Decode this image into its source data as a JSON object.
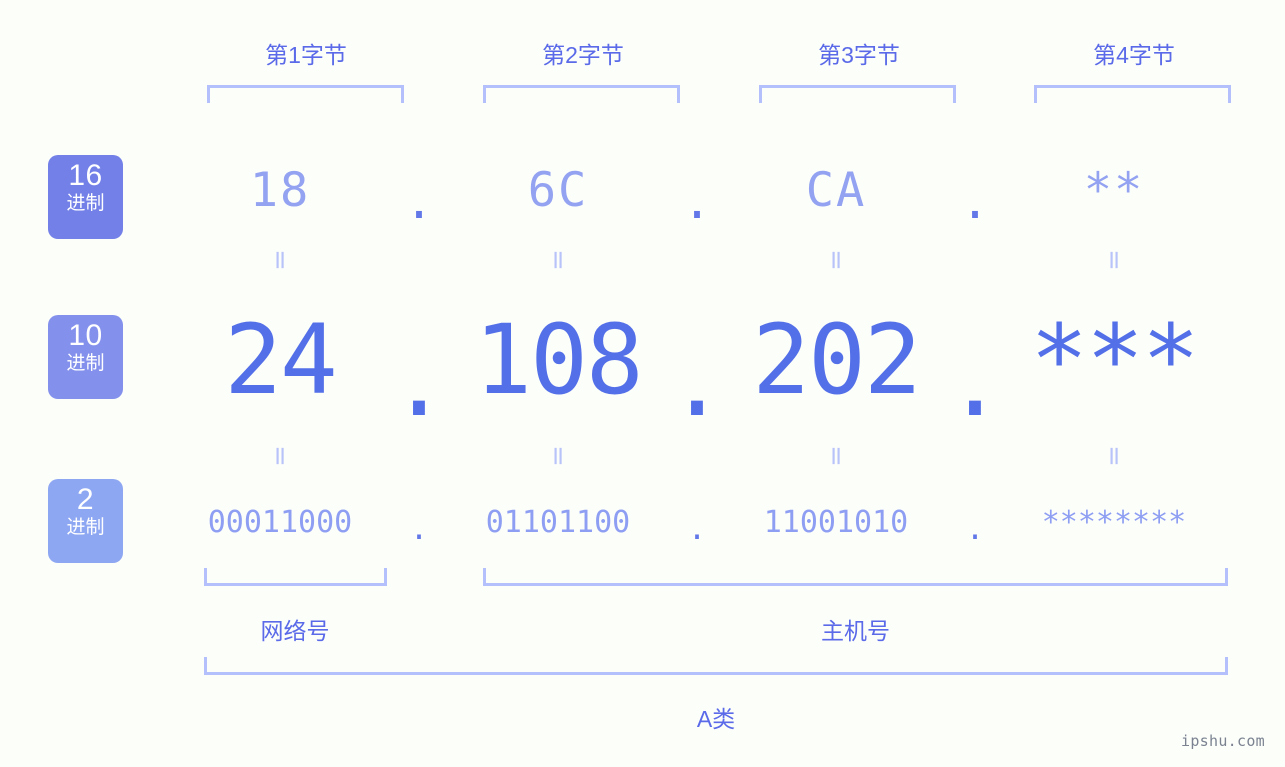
{
  "header": {
    "byte_labels": [
      "第1字节",
      "第2字节",
      "第3字节",
      "第4字节"
    ]
  },
  "badges": {
    "hex": {
      "num": "16",
      "suffix": "进制",
      "color": "#7280e8"
    },
    "dec": {
      "num": "10",
      "suffix": "进制",
      "color": "#8491ec"
    },
    "binary": {
      "num": "2",
      "suffix": "进制",
      "color": "#8ea7f2"
    }
  },
  "rows": {
    "hex": {
      "values": [
        "18",
        "6C",
        "CA",
        "**"
      ],
      "separators": [
        ".",
        ".",
        "."
      ]
    },
    "decimal": {
      "values": [
        "24",
        "108",
        "202",
        "***"
      ],
      "separators": [
        ".",
        ".",
        "."
      ]
    },
    "binary": {
      "values": [
        "00011000",
        "01101100",
        "11001010",
        "********"
      ],
      "separators": [
        ".",
        ".",
        "."
      ]
    }
  },
  "equals": {
    "symbol": "=",
    "row1": [
      "=",
      "=",
      "=",
      "="
    ],
    "row2": [
      "=",
      "=",
      "=",
      "="
    ]
  },
  "sections": {
    "network": "网络号",
    "host": "主机号",
    "ip_class": "A类"
  },
  "watermark": "ipshu.com",
  "colors": {
    "background": "#fcfefa",
    "accent_strong": "#5470e8",
    "accent_mid": "#8e9ef2",
    "accent_light": "#b4c0fb",
    "label": "#5a6ae8",
    "watermark": "#7b8391"
  }
}
